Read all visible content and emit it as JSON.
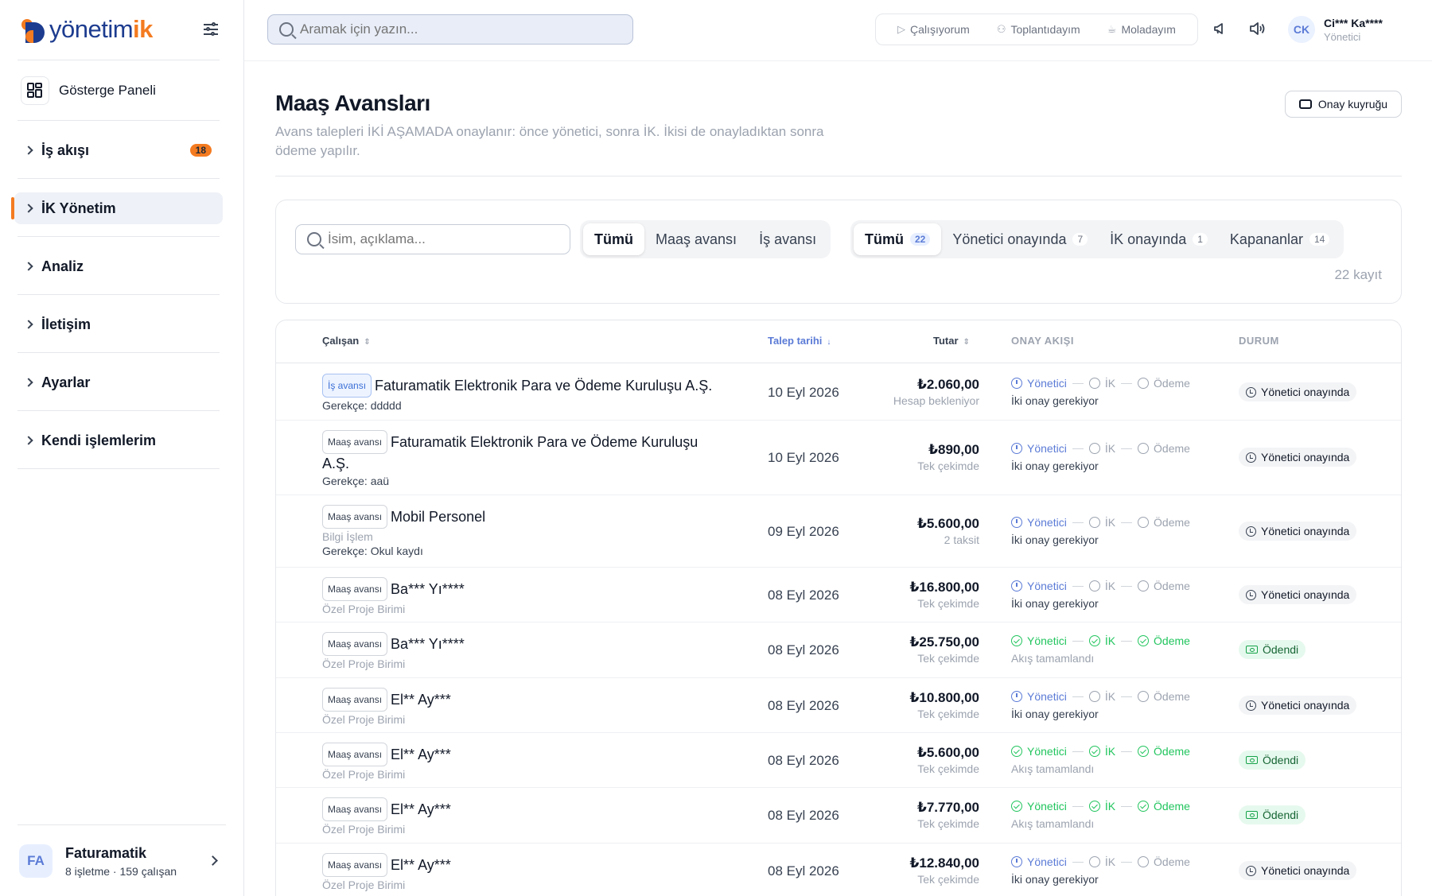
{
  "app": {
    "brand_main": "yönetim",
    "brand_accent": "ik"
  },
  "sidebar": {
    "dashboard_label": "Gösterge Paneli",
    "items": [
      {
        "label": "İş akışı",
        "badge": "18"
      },
      {
        "label": "İK Yönetim"
      },
      {
        "label": "Analiz"
      },
      {
        "label": "İletişim"
      },
      {
        "label": "Ayarlar"
      },
      {
        "label": "Kendi işlemlerim"
      }
    ],
    "org": {
      "avatar": "FA",
      "name": "Faturamatik",
      "sub": "8 işletme · 159 çalışan"
    }
  },
  "topbar": {
    "search_placeholder": "Aramak için yazın...",
    "status_buttons": [
      "Çalışıyorum",
      "Toplantıdayım",
      "Moladayım"
    ],
    "user": {
      "initials": "CK",
      "name": "Ci*** Ka****",
      "role": "Yönetici"
    }
  },
  "page": {
    "title": "Maaş Avansları",
    "description": "Avans talepleri İKİ AŞAMADA onaylanır: önce yönetici, sonra İK. İkisi de onayladıktan sonra ödeme yapılır.",
    "queue_button": "Onay kuyruğu"
  },
  "filters": {
    "search_placeholder": "İsim, açıklama...",
    "type_tabs": [
      "Tümü",
      "Maaş avansı",
      "İş avansı"
    ],
    "status_tabs": [
      {
        "label": "Tümü",
        "count": "22"
      },
      {
        "label": "Yönetici onayında",
        "count": "7"
      },
      {
        "label": "İK onayında",
        "count": "1"
      },
      {
        "label": "Kapananlar",
        "count": "14"
      }
    ],
    "record_count": "22 kayıt"
  },
  "table": {
    "headers": {
      "employee": "Çalışan",
      "date": "Talep tarihi",
      "amount": "Tutar",
      "flow": "ONAY AKIŞI",
      "status": "DURUM"
    },
    "step_labels": [
      "Yönetici",
      "İK",
      "Ödeme"
    ],
    "rows": [
      {
        "tag": "İş avansı",
        "name": "Faturamatik Elektronik Para ve Ödeme Kuruluşu A.Ş.",
        "unit": "",
        "reason": "Gerekçe: ddddd",
        "date": "10 Eyl 2026",
        "amount": "₺2.060,00",
        "amount_sub": "Hesap bekleniyor",
        "flow_note": "İki onay gerekiyor",
        "status": "Yönetici onayında"
      },
      {
        "tag": "Maaş avansı",
        "name": "Faturamatik Elektronik Para ve Ödeme Kuruluşu A.Ş.",
        "unit": "",
        "reason": "Gerekçe: aaü",
        "date": "10 Eyl 2026",
        "amount": "₺890,00",
        "amount_sub": "Tek çekimde",
        "flow_note": "İki onay gerekiyor",
        "status": "Yönetici onayında"
      },
      {
        "tag": "Maaş avansı",
        "name": "Mobil Personel",
        "unit": "Bilgi İşlem",
        "reason": "Gerekçe: Okul kaydı",
        "date": "09 Eyl 2026",
        "amount": "₺5.600,00",
        "amount_sub": "2 taksit",
        "flow_note": "İki onay gerekiyor",
        "status": "Yönetici onayında"
      },
      {
        "tag": "Maaş avansı",
        "name": "Ba*** Yı****",
        "unit": "Özel Proje Birimi",
        "reason": "",
        "date": "08 Eyl 2026",
        "amount": "₺16.800,00",
        "amount_sub": "Tek çekimde",
        "flow_note": "İki onay gerekiyor",
        "status": "Yönetici onayında"
      },
      {
        "tag": "Maaş avansı",
        "name": "Ba*** Yı****",
        "unit": "Özel Proje Birimi",
        "reason": "",
        "date": "08 Eyl 2026",
        "amount": "₺25.750,00",
        "amount_sub": "Tek çekimde",
        "flow_note": "Akış tamamlandı",
        "status": "Ödendi"
      },
      {
        "tag": "Maaş avansı",
        "name": "El** Ay***",
        "unit": "Özel Proje Birimi",
        "reason": "",
        "date": "08 Eyl 2026",
        "amount": "₺10.800,00",
        "amount_sub": "Tek çekimde",
        "flow_note": "İki onay gerekiyor",
        "status": "Yönetici onayında"
      },
      {
        "tag": "Maaş avansı",
        "name": "El** Ay***",
        "unit": "Özel Proje Birimi",
        "reason": "",
        "date": "08 Eyl 2026",
        "amount": "₺5.600,00",
        "amount_sub": "Tek çekimde",
        "flow_note": "Akış tamamlandı",
        "status": "Ödendi"
      },
      {
        "tag": "Maaş avansı",
        "name": "El** Ay***",
        "unit": "Özel Proje Birimi",
        "reason": "",
        "date": "08 Eyl 2026",
        "amount": "₺7.770,00",
        "amount_sub": "Tek çekimde",
        "flow_note": "Akış tamamlandı",
        "status": "Ödendi"
      },
      {
        "tag": "Maaş avansı",
        "name": "El** Ay***",
        "unit": "Özel Proje Birimi",
        "reason": "",
        "date": "08 Eyl 2026",
        "amount": "₺12.840,00",
        "amount_sub": "Tek çekimde",
        "flow_note": "İki onay gerekiyor",
        "status": "Yönetici onayında"
      }
    ]
  }
}
